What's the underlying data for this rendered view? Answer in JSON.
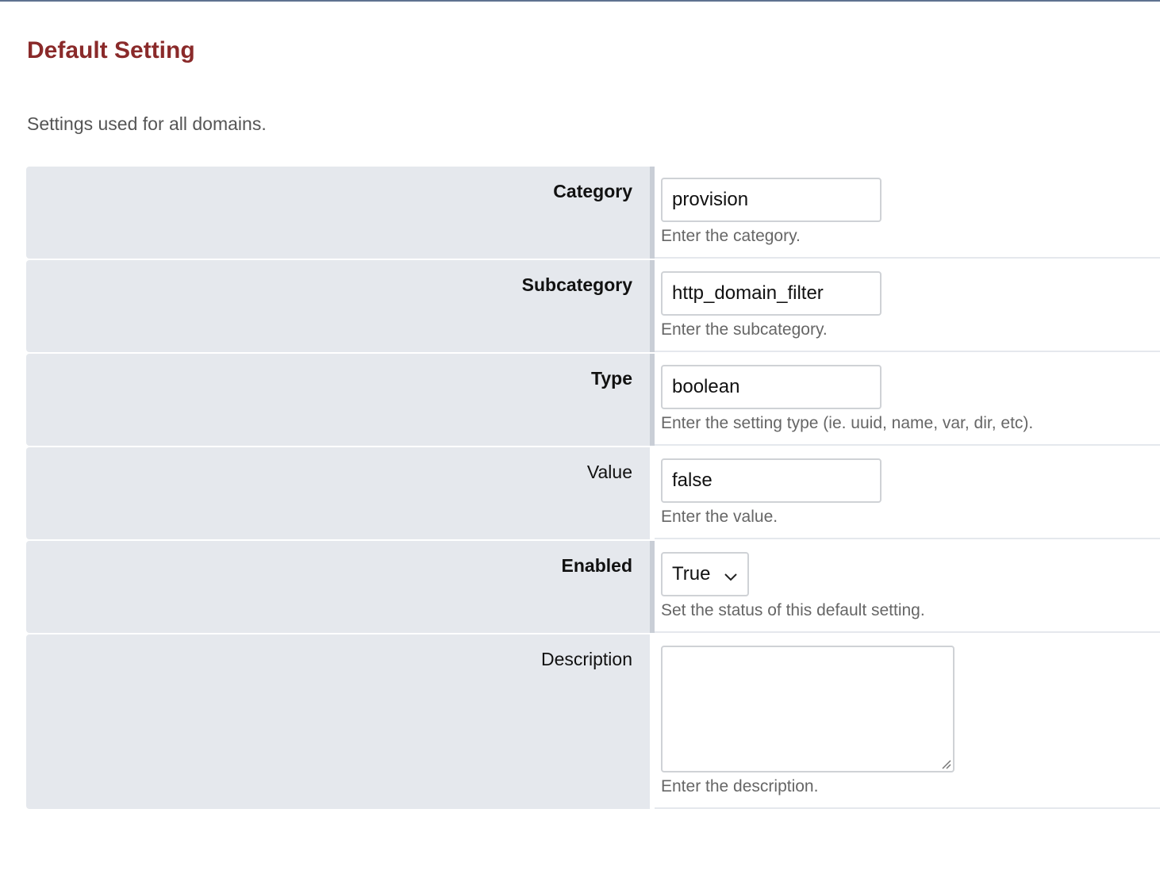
{
  "page": {
    "title": "Default Setting",
    "subtitle": "Settings used for all domains."
  },
  "form": {
    "category": {
      "label": "Category",
      "value": "provision",
      "help": "Enter the category."
    },
    "subcategory": {
      "label": "Subcategory",
      "value": "http_domain_filter",
      "help": "Enter the subcategory."
    },
    "type": {
      "label": "Type",
      "value": "boolean",
      "help": "Enter the setting type (ie. uuid, name, var, dir, etc)."
    },
    "value": {
      "label": "Value",
      "value": "false",
      "help": "Enter the value."
    },
    "enabled": {
      "label": "Enabled",
      "selected": "True",
      "help": "Set the status of this default setting."
    },
    "description": {
      "label": "Description",
      "value": "",
      "help": "Enter the description."
    }
  },
  "colors": {
    "title": "#8a2a2a",
    "label_background": "#e5e8ed",
    "help_text": "#666666"
  },
  "icons": {
    "select_arrow": "chevron-down-icon",
    "textarea_resize": "resize-grip-icon"
  }
}
